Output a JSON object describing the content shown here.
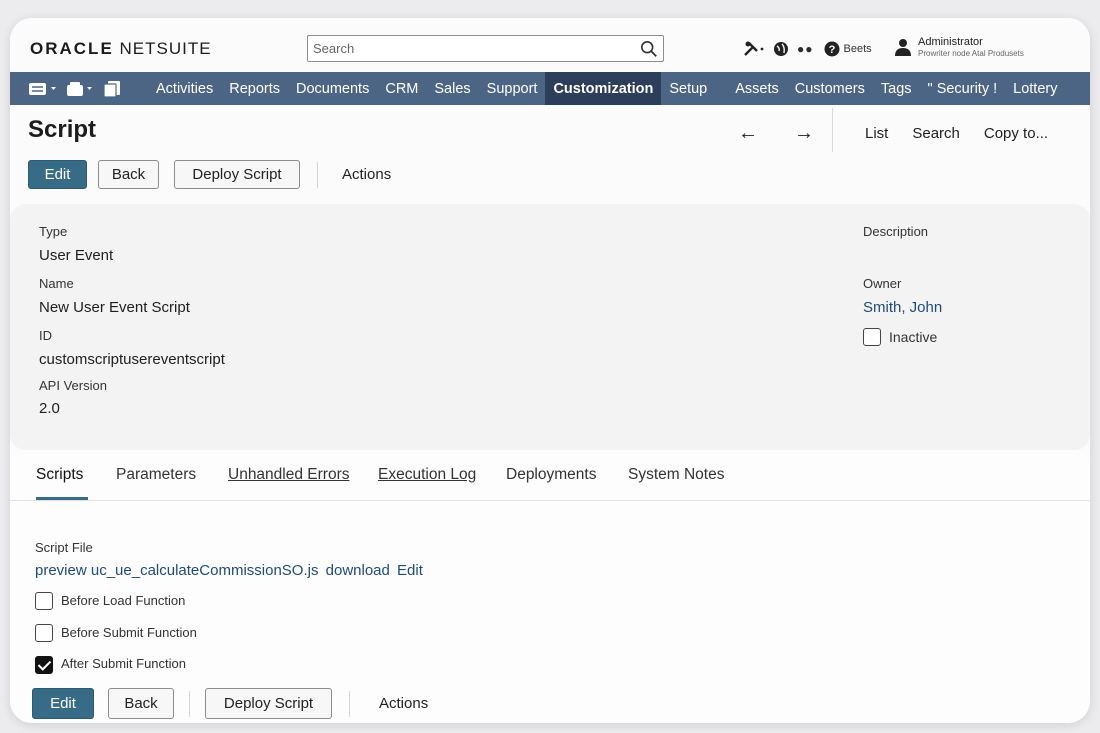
{
  "header": {
    "logo_oracle": "ORACLE",
    "logo_netsuite": "NETSUITE",
    "search_placeholder": "Search",
    "help_label": "Beets",
    "user_name": "Administrator",
    "user_role": "Prowriter node Atal Produsets"
  },
  "nav": {
    "tabs": [
      "Activities",
      "Reports",
      "Documents",
      "CRM",
      "Sales",
      "Support",
      "Customization",
      "Setup",
      "Assets",
      "Customers",
      "Tags",
      "\" Security !",
      "Lottery"
    ],
    "active": "Customization"
  },
  "page": {
    "title": "Script",
    "prev_arrow": "←",
    "next_arrow": "→",
    "links": [
      "List",
      "Search",
      "Copy to..."
    ]
  },
  "buttons": {
    "edit": "Edit",
    "back": "Back",
    "deploy": "Deploy Script",
    "actions": "Actions"
  },
  "fields": {
    "type_label": "Type",
    "type_value": "User Event",
    "name_label": "Name",
    "name_value": "New User Event Script",
    "id_label": "ID",
    "id_value": "customscriptusereventscript",
    "api_label": "API Version",
    "api_value": "2.0",
    "description_label": "Description",
    "owner_label": "Owner",
    "owner_value": "Smith, John",
    "inactive_label": "Inactive",
    "inactive_checked": false
  },
  "subtabs": {
    "items": [
      "Scripts",
      "Parameters",
      "Unhandled Errors",
      "Execution Log",
      "Deployments",
      "System Notes"
    ],
    "active": "Scripts"
  },
  "scripts": {
    "file_label": "Script File",
    "preview": "preview",
    "filename": "uc_ue_calculateCommissionSO.js",
    "download": "download",
    "edit": "Edit",
    "before_load": "Before Load Function",
    "before_load_checked": false,
    "before_submit": "Before Submit Function",
    "before_submit_checked": false,
    "after_submit": "After Submit Function",
    "after_submit_checked": true
  },
  "colors": {
    "nav_bg": "#4d6584",
    "nav_active": "#2c3e5a",
    "primary_button": "#386c86",
    "link": "#1f4b78"
  }
}
